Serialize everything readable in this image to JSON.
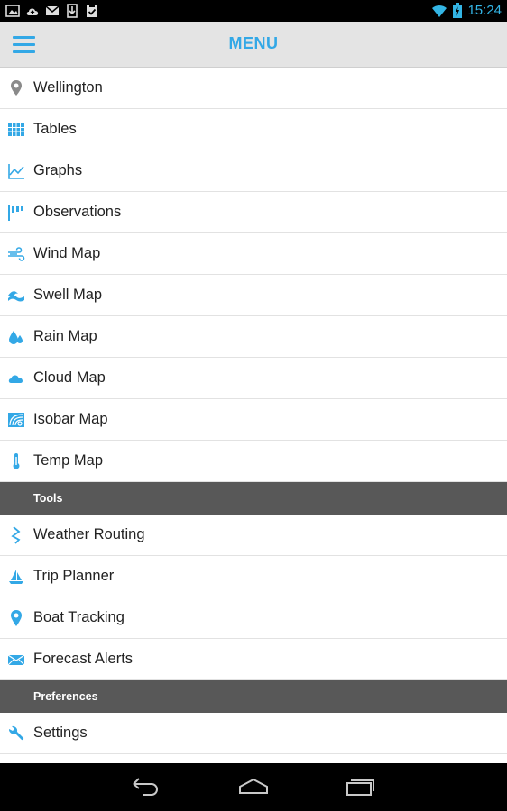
{
  "status_bar": {
    "time": "15:24",
    "notification_icons": [
      "image-icon",
      "cloud-upload-icon",
      "mail-icon",
      "download-icon",
      "clipboard-check-icon"
    ]
  },
  "app_bar": {
    "title": "MENU"
  },
  "menu": {
    "items": [
      {
        "label": "Wellington",
        "icon": "location-pin-icon"
      },
      {
        "label": "Tables",
        "icon": "table-grid-icon"
      },
      {
        "label": "Graphs",
        "icon": "line-graph-icon"
      },
      {
        "label": "Observations",
        "icon": "flag-icon"
      },
      {
        "label": "Wind Map",
        "icon": "wind-icon"
      },
      {
        "label": "Swell Map",
        "icon": "wave-icon"
      },
      {
        "label": "Rain Map",
        "icon": "raindrop-icon"
      },
      {
        "label": "Cloud Map",
        "icon": "cloud-icon"
      },
      {
        "label": "Isobar Map",
        "icon": "isobar-icon"
      },
      {
        "label": "Temp Map",
        "icon": "thermometer-icon"
      }
    ],
    "tools_header": "Tools",
    "tools": [
      {
        "label": "Weather Routing",
        "icon": "route-icon"
      },
      {
        "label": "Trip Planner",
        "icon": "sailboat-icon"
      },
      {
        "label": "Boat Tracking",
        "icon": "map-marker-icon"
      },
      {
        "label": "Forecast Alerts",
        "icon": "alert-mail-icon"
      }
    ],
    "preferences_header": "Preferences",
    "preferences": [
      {
        "label": "Settings",
        "icon": "wrench-icon"
      }
    ]
  },
  "colors": {
    "accent": "#33a8e6",
    "section_header_bg": "#585858",
    "app_bar_bg": "#e4e4e4"
  }
}
